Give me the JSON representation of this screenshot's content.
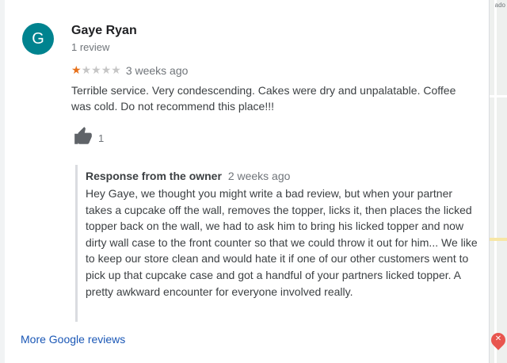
{
  "map": {
    "corner_label": "ado",
    "pin_icon": "restaurant-pin-icon"
  },
  "review": {
    "avatar_letter": "G",
    "avatar_color": "#00838f",
    "reviewer_name": "Gaye Ryan",
    "reviewer_meta": "1 review",
    "rating": 1,
    "rating_max": 5,
    "star_color": "#e7711b",
    "time": "3 weeks ago",
    "text": "Terrible service. Very condescending. Cakes were dry and unpalatable. Coffee was cold. Do not recommend this place!!!",
    "like_icon": "thumbs-up-icon",
    "like_count": "1"
  },
  "owner_response": {
    "title": "Response from the owner",
    "time": "2 weeks ago",
    "text": "Hey Gaye, we thought you might write a bad review, but when your partner takes a cupcake off the wall, removes the topper, licks it, then places the licked topper back on the wall, we had to ask him to bring his licked topper and now dirty wall case to the front counter so that we could throw it out for him... We like to keep our store clean and would hate it if one of our other customers went to pick up that cupcake case and got a handful of your partners licked topper. A pretty awkward encounter for everyone involved really."
  },
  "footer": {
    "more_reviews_label": "More Google reviews",
    "link_color": "#1a57b6"
  }
}
